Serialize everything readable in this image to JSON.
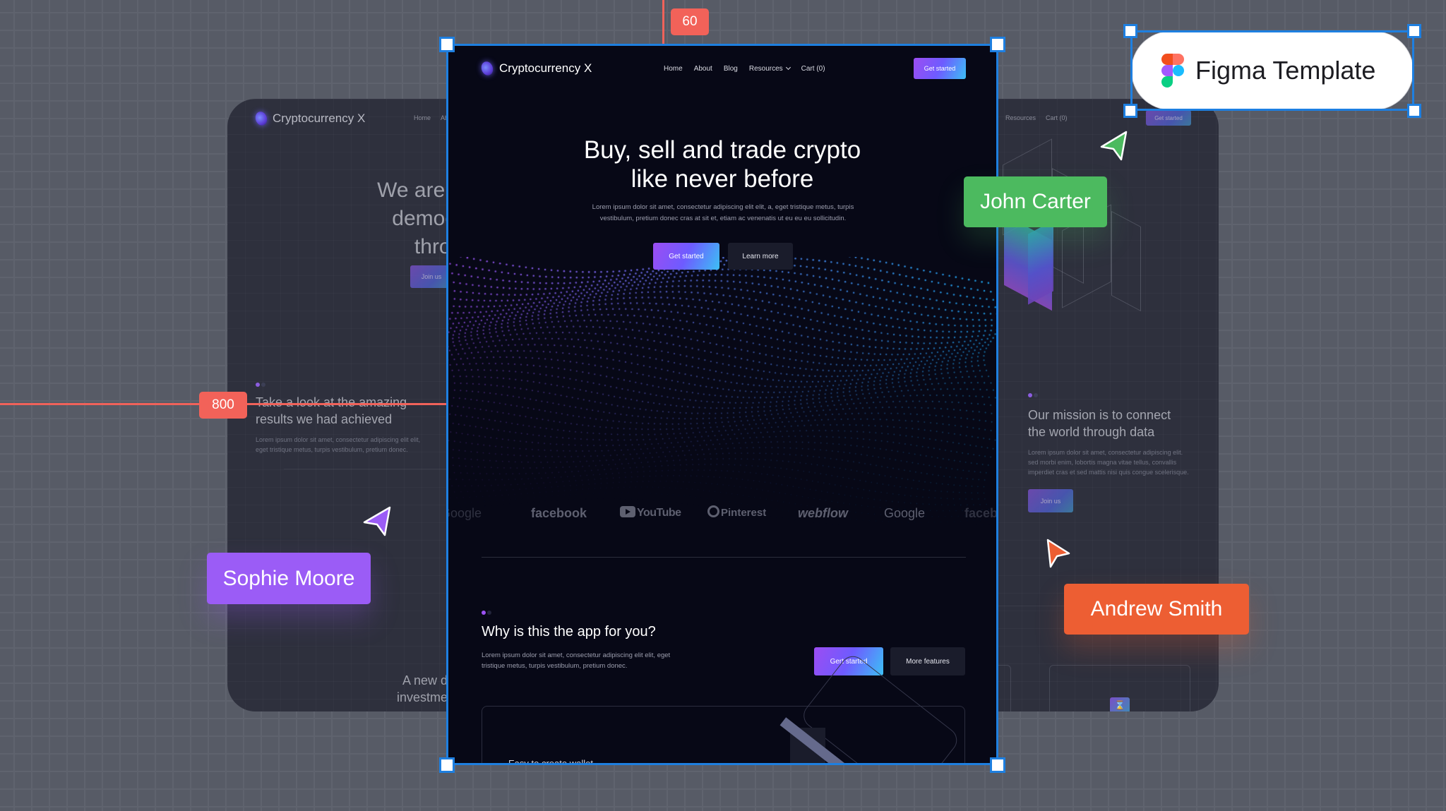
{
  "background_page_left": {
    "brand_name": "Cryptocurrency X",
    "nav": [
      "Home",
      "About"
    ],
    "hero_title_lines": [
      "We are on",
      "democra",
      "throug"
    ],
    "hero_button": "Join us",
    "section_title_lines": [
      "Take a look at the amazing",
      "results we had achieved"
    ],
    "section_desc_lines": [
      "Lorem ipsum dolor sit amet, consectetur adipiscing elit elit,",
      "eget tristique metus, turpis vestibulum, pretium donec."
    ],
    "bottom_title_lines": [
      "A new d",
      "investme"
    ]
  },
  "background_page_right": {
    "nav": [
      "Resources",
      "Cart (0)"
    ],
    "nav_cta": "Get started",
    "section_title_lines": [
      "Our mission is to connect",
      "the world through data"
    ],
    "section_desc_lines": [
      "Lorem ipsum dolor sit amet, consectetur adipiscing elit.",
      "sed morbi enim, lobortis magna vitae tellus, convallis",
      "imperdiet cras et sed mattis nisi quis congue scelerisque."
    ],
    "section_button": "Join us"
  },
  "artboard": {
    "brand_name": "Cryptocurrency X",
    "nav": [
      {
        "label": "Home"
      },
      {
        "label": "About"
      },
      {
        "label": "Blog"
      },
      {
        "label": "Resources",
        "has_dropdown": true
      },
      {
        "label": "Cart (0)"
      }
    ],
    "nav_cta": "Get started",
    "hero": {
      "title_lines": [
        "Buy, sell and trade crypto",
        "like never before"
      ],
      "subtitle": "Lorem ipsum dolor sit amet, consectetur adipiscing elit elit, a, eget tristique metus, turpis vestibulum, pretium donec cras at sit et, etiam ac venenatis ut eu eu eu sollicitudin.",
      "primary_button": "Get started",
      "secondary_button": "Learn more"
    },
    "logos": [
      "Google",
      "facebook",
      "YouTube",
      "Pinterest",
      "webflow",
      "Google",
      "facebook"
    ],
    "features_section": {
      "title": "Why is this the app for you?",
      "description": "Lorem ipsum dolor sit amet, consectetur adipiscing elit elit, eget tristique metus, turpis vestibulum, pretium donec.",
      "primary_button": "Gert started",
      "secondary_button": "More features",
      "card_title": "Easy to create wallet"
    }
  },
  "overlays": {
    "measure_top": "60",
    "measure_left": "800",
    "collaborators": [
      {
        "name": "Sophie Moore",
        "color": "#9b5cf6"
      },
      {
        "name": "John Carter",
        "color": "#4cba5f"
      },
      {
        "name": "Andrew Smith",
        "color": "#ed5e33"
      }
    ],
    "template_badge": "Figma Template"
  },
  "colors": {
    "canvas_bg": "#575b66",
    "artboard_bg": "#070816",
    "selection": "#1e7fe0",
    "gradient_start": "#9c4df2",
    "gradient_end": "#3cc0f5",
    "measure": "#f26259"
  }
}
